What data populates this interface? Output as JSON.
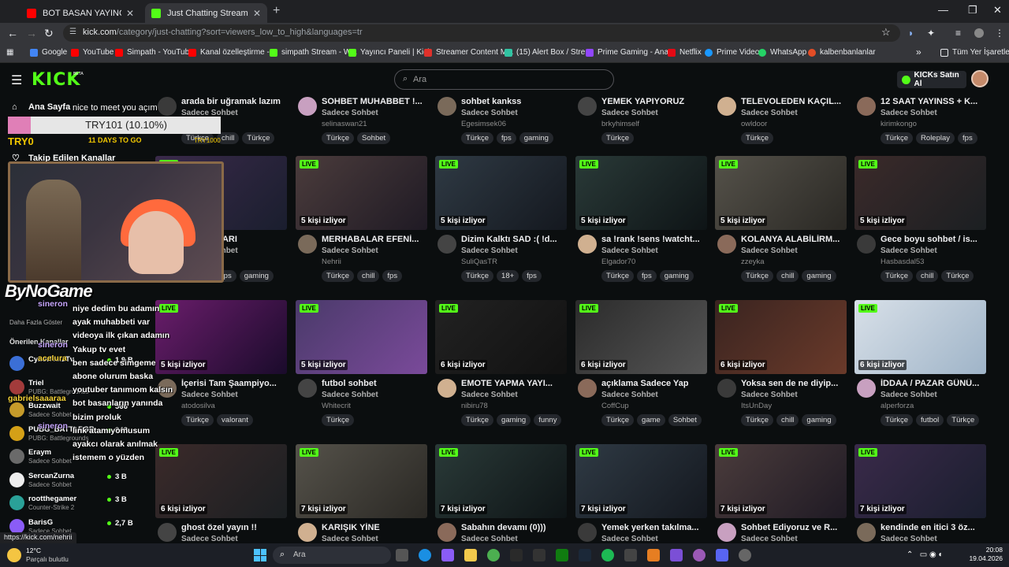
{
  "browser": {
    "tabs": [
      {
        "title": "BOT BASAN YAYINCILARI TROLL",
        "active": false
      },
      {
        "title": "Just Chatting Streaming - Live S",
        "active": true
      }
    ],
    "new_tab": "+",
    "url_host": "kick.com",
    "url_path": "/category/just-chatting?sort=viewers_low_to_high&languages=tr",
    "bookmarks": [
      "Google",
      "YouTube",
      "Simpath - YouTube",
      "Kanal özelleştirme -...",
      "simpath Stream - W...",
      "Yayıncı Paneli | Kick",
      "Streamer Content M...",
      "(15) Alert Box / Stre...",
      "Prime Gaming - Ana...",
      "Netflix",
      "Prime Video",
      "WhatsApp",
      "kalbenbanlanlar"
    ],
    "bookmarks_more": "»",
    "all_bookmarks": "Tüm Yer İşaretleri"
  },
  "header": {
    "logo": "KICK",
    "beta": "BETA",
    "search_placeholder": "Ara",
    "kicks_button": "KICKs Satın Al"
  },
  "sidebar": {
    "home": "Ana Sayfa",
    "following": "Takip Edilen Kanallar",
    "show_more": "Daha Fazla Göster",
    "recommended_title": "Önerilen Kanallar",
    "channels": [
      {
        "name": "CyberRulzTv",
        "game": "",
        "count": "1,9 B"
      },
      {
        "name": "Triel",
        "game": "PUBG: Battlegrounds",
        "count": ""
      },
      {
        "name": "Buzzwait",
        "game": "Sadece Sohbet",
        "count": "566"
      },
      {
        "name": "PUBG_BATTLEGR...",
        "game": "PUBG: Battlegrounds",
        "count": "943"
      },
      {
        "name": "Eraym",
        "game": "Sadece Sohbet",
        "count": ""
      },
      {
        "name": "SercanZurna",
        "game": "Sadece Sohbet",
        "count": "3 B"
      },
      {
        "name": "rootthegamer",
        "game": "Counter-Strike 2",
        "count": "3 B"
      },
      {
        "name": "BarisG",
        "game": "Sadece Sohbet",
        "count": "2,7 B"
      }
    ]
  },
  "overlay": {
    "nice": "nice to meet you açım",
    "goal": "TRY101 (10.10%)",
    "goal_fraction": 0.101,
    "try0": "TRY0",
    "days": "11 DAYS TO GO",
    "try1000": "TRY1000",
    "brand": "ByNoGame",
    "chat": [
      {
        "name": "sineron",
        "msg": "niye dedim bu adamın"
      },
      {
        "name": "",
        "msg": "ayak muhabbeti var"
      },
      {
        "name": "",
        "msg": "videoya ilk çıkan adamın"
      },
      {
        "name": "sineron",
        "msg": "Yakup tv evet"
      },
      {
        "name": "aceIura",
        "msg": "ben sadece simgeme"
      },
      {
        "name": "",
        "msg": "abone olurum baska"
      },
      {
        "name": "",
        "msg": "youtuber tanımıom kalsın"
      },
      {
        "name": "gabrielsaaaraa",
        "msg": "bot basanların yanında"
      },
      {
        "name": "",
        "msg": "bizim proluk"
      },
      {
        "name": "sineron",
        "msg": "link atamıyomusum"
      },
      {
        "name": "",
        "msg": "ayakcı olarak anılmak"
      },
      {
        "name": "",
        "msg": "istemem o yüzden"
      }
    ]
  },
  "streams_top": [
    {
      "title": "arada bir uğramak lazım",
      "category": "Sadece Sohbet",
      "streamer": "",
      "tags": [
        "Türkçe",
        "chill",
        "Türkçe"
      ]
    },
    {
      "title": "SOHBET MUHABBET !...",
      "category": "Sadece Sohbet",
      "streamer": "selinaswan21",
      "tags": [
        "Türkçe",
        "Sohbet"
      ]
    },
    {
      "title": "sohbet kankss",
      "category": "Sadece Sohbet",
      "streamer": "Egesimsek06",
      "tags": [
        "Türkçe",
        "fps",
        "gaming"
      ]
    },
    {
      "title": "YEMEK YAPIYORUZ",
      "category": "Sadece Sohbet",
      "streamer": "brkyhimself",
      "tags": [
        "Türkçe"
      ]
    },
    {
      "title": "TELEVOLEDEN KAÇIL...",
      "category": "Sadece Sohbet",
      "streamer": "owldoor",
      "tags": [
        "Türkçe"
      ]
    },
    {
      "title": "12 SAAT YAYINSS + K...",
      "category": "Sadece Sohbet",
      "streamer": "kirimkongo",
      "tags": [
        "Türkçe",
        "Roleplay",
        "fps"
      ]
    }
  ],
  "streams_row2": [
    {
      "title": "...O DAĞLARI",
      "category": "Sadece Sohbet",
      "streamer": "",
      "viewers": "",
      "tags": [
        "Türkçe",
        "fps",
        "gaming"
      ]
    },
    {
      "title": "MERHABALAR EFENİ...",
      "category": "Sadece Sohbet",
      "streamer": "Nehrii",
      "viewers": "5 kişi izliyor",
      "tags": [
        "Türkçe",
        "chill",
        "fps"
      ]
    },
    {
      "title": "Dizim Kalktı SAD :( !d...",
      "category": "Sadece Sohbet",
      "streamer": "SuliQasTR",
      "viewers": "5 kişi izliyor",
      "tags": [
        "Türkçe",
        "18+",
        "fps"
      ]
    },
    {
      "title": "sa !rank !sens !watcht...",
      "category": "Sadece Sohbet",
      "streamer": "Elgador70",
      "viewers": "5 kişi izliyor",
      "tags": [
        "Türkçe",
        "fps",
        "gaming"
      ]
    },
    {
      "title": "KOLANYA ALABİLİRM...",
      "category": "Sadece Sohbet",
      "streamer": "zzeyka",
      "viewers": "5 kişi izliyor",
      "tags": [
        "Türkçe",
        "chill",
        "gaming"
      ]
    },
    {
      "title": "Gece boyu sohbet / is...",
      "category": "Sadece Sohbet",
      "streamer": "Hasbasdal53",
      "viewers": "5 kişi izliyor",
      "tags": [
        "Türkçe",
        "chill",
        "Türkçe"
      ]
    }
  ],
  "streams_row3": [
    {
      "title": "İçerisi Tam Şaampiyo...",
      "category": "Sadece Sohbet",
      "streamer": "atodosilva",
      "viewers": "5 kişi izliyor",
      "tags": [
        "Türkçe",
        "valorant"
      ]
    },
    {
      "title": "futbol sohbet",
      "category": "Sadece Sohbet",
      "streamer": "Whitecrit",
      "viewers": "5 kişi izliyor",
      "tags": [
        "Türkçe"
      ]
    },
    {
      "title": "EMOTE YAPMA YAYI...",
      "category": "Sadece Sohbet",
      "streamer": "nibiru78",
      "viewers": "6 kişi izliyor",
      "tags": [
        "Türkçe",
        "gaming",
        "funny"
      ]
    },
    {
      "title": "açıklama Sadece Yap",
      "category": "Sadece Sohbet",
      "streamer": "CoffCup",
      "viewers": "6 kişi izliyor",
      "tags": [
        "Türkçe",
        "game",
        "Sohbet"
      ]
    },
    {
      "title": "Yoksa sen de ne diyip...",
      "category": "Sadece Sohbet",
      "streamer": "ItsUnDay",
      "viewers": "6 kişi izliyor",
      "tags": [
        "Türkçe",
        "chill",
        "gaming"
      ]
    },
    {
      "title": "İDDAA / PAZAR GÜNÜ...",
      "category": "Sadece Sohbet",
      "streamer": "alperforza",
      "viewers": "6 kişi izliyor",
      "tags": [
        "Türkçe",
        "futbol",
        "Türkçe"
      ]
    }
  ],
  "streams_row4": [
    {
      "title": "ghost özel yayın !!",
      "category": "Sadece Sohbet",
      "streamer": "",
      "viewers": "6 kişi izliyor",
      "tags": []
    },
    {
      "title": "KARIŞIK YİNE",
      "category": "Sadece Sohbet",
      "streamer": "",
      "viewers": "7 kişi izliyor",
      "tags": []
    },
    {
      "title": "Sabahın devamı (0)))",
      "category": "Sadece Sohbet",
      "streamer": "",
      "viewers": "7 kişi izliyor",
      "tags": []
    },
    {
      "title": "Yemek yerken takılma...",
      "category": "Sadece Sohbet",
      "streamer": "",
      "viewers": "7 kişi izliyor",
      "tags": []
    },
    {
      "title": "Sohbet Ediyoruz ve R...",
      "category": "Sadece Sohbet",
      "streamer": "",
      "viewers": "7 kişi izliyor",
      "tags": []
    },
    {
      "title": "kendinde en itici 3 öz...",
      "category": "Sadece Sohbet",
      "streamer": "",
      "viewers": "7 kişi izliyor",
      "tags": []
    }
  ],
  "live_label": "LIVE",
  "status_url": "https://kick.com/nehrii",
  "taskbar": {
    "temp": "12°C",
    "weather": "Parçalı bulutlu",
    "search": "Ara",
    "time": "20:08",
    "date": "19.04.2026"
  }
}
